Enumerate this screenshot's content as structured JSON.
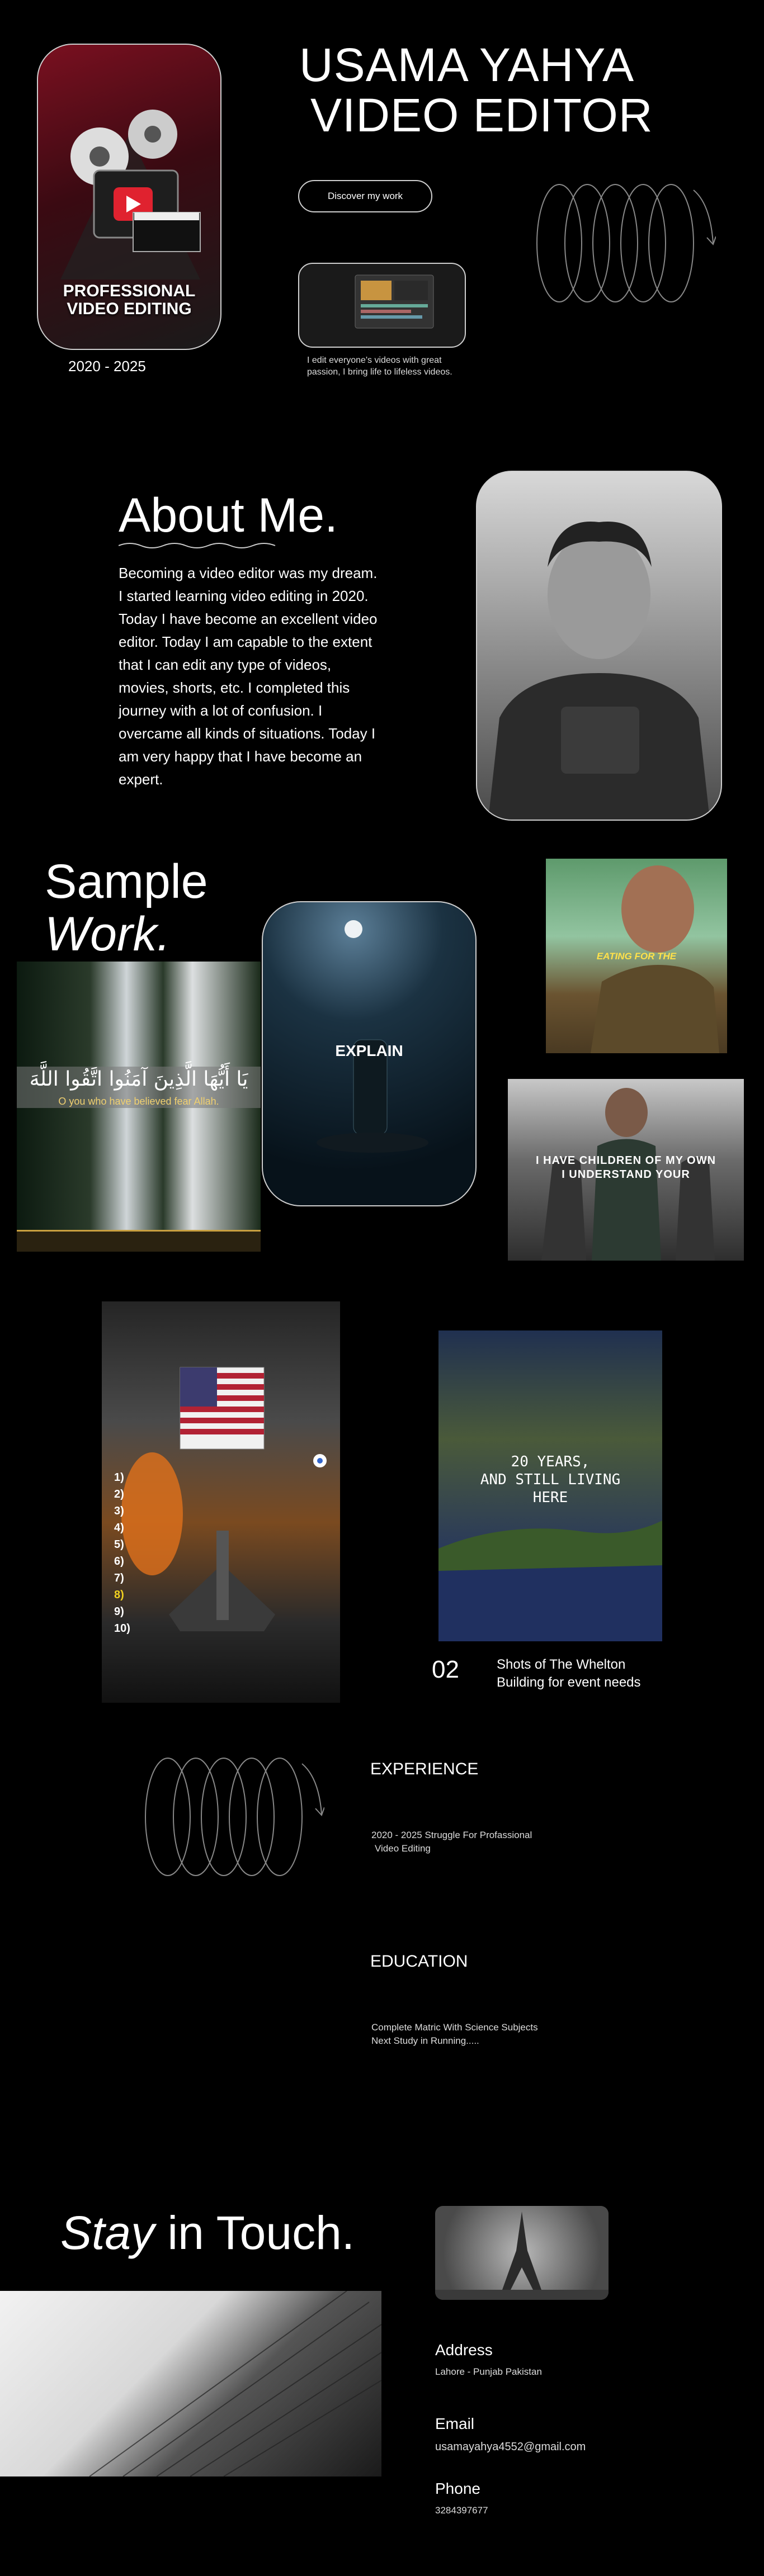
{
  "hero": {
    "badge_title": "PROFESSIONAL\nVIDEO EDITING",
    "years": "2020 - 2025",
    "name": "USAMA YAHYA",
    "role": "VIDEO EDITOR",
    "cta": "Discover my work",
    "tagline": "I edit everyone's videos with great passion, I bring life to lifeless videos."
  },
  "about": {
    "title": "About Me.",
    "body": "Becoming a video editor was my dream. I started learning video editing in 2020. Today I have become an excellent video editor. Today I am capable to the extent that I can edit any type of videos, movies, shorts, etc. I completed this journey with a lot of confusion. I overcame all kinds of situations. Today I am very happy that I have become an expert."
  },
  "sample": {
    "title_a": "Sample",
    "title_b": "Work.",
    "arabic_line": "يَا أَيُّهَا الَّذِينَ آمَنُوا اتَّقُوا اللَّهَ",
    "arabic_sub": "O you who have believed fear Allah.",
    "explain": "EXPLAIN",
    "eating": "EATING FOR THE",
    "children_l1": "I HAVE CHILDREN OF MY OWN",
    "children_l2": "I UNDERSTAND YOUR",
    "years_alive_l1": "20 YEARS,",
    "years_alive_l2": "AND STILL LIVING",
    "years_alive_l3": "HERE",
    "countdown": [
      "1)",
      "2)",
      "3)",
      "4)",
      "5)",
      "6)",
      "7)",
      "8)",
      "9)",
      "10)"
    ],
    "number": "02",
    "caption": "Shots of The Whelton Building for event needs"
  },
  "experience": {
    "heading": "EXPERIENCE",
    "text_l1": "2020 - 2025 Struggle For Profassional",
    "text_l2": "Video Editing"
  },
  "education": {
    "heading": "EDUCATION",
    "text_l1": "Complete Matric With Science Subjects",
    "text_l2": "Next Study in Running....."
  },
  "contact": {
    "title_a": "Stay",
    "title_b": " in Touch.",
    "address_label": "Address",
    "address": "Lahore - Punjab Pakistan",
    "email_label": "Email",
    "email": "usamayahya4552@gmail.com",
    "phone_label": "Phone",
    "phone": "3284397677"
  },
  "colors": {
    "background": "#000000",
    "accent_red": "#c8102e",
    "border": "#cfcfcf"
  }
}
